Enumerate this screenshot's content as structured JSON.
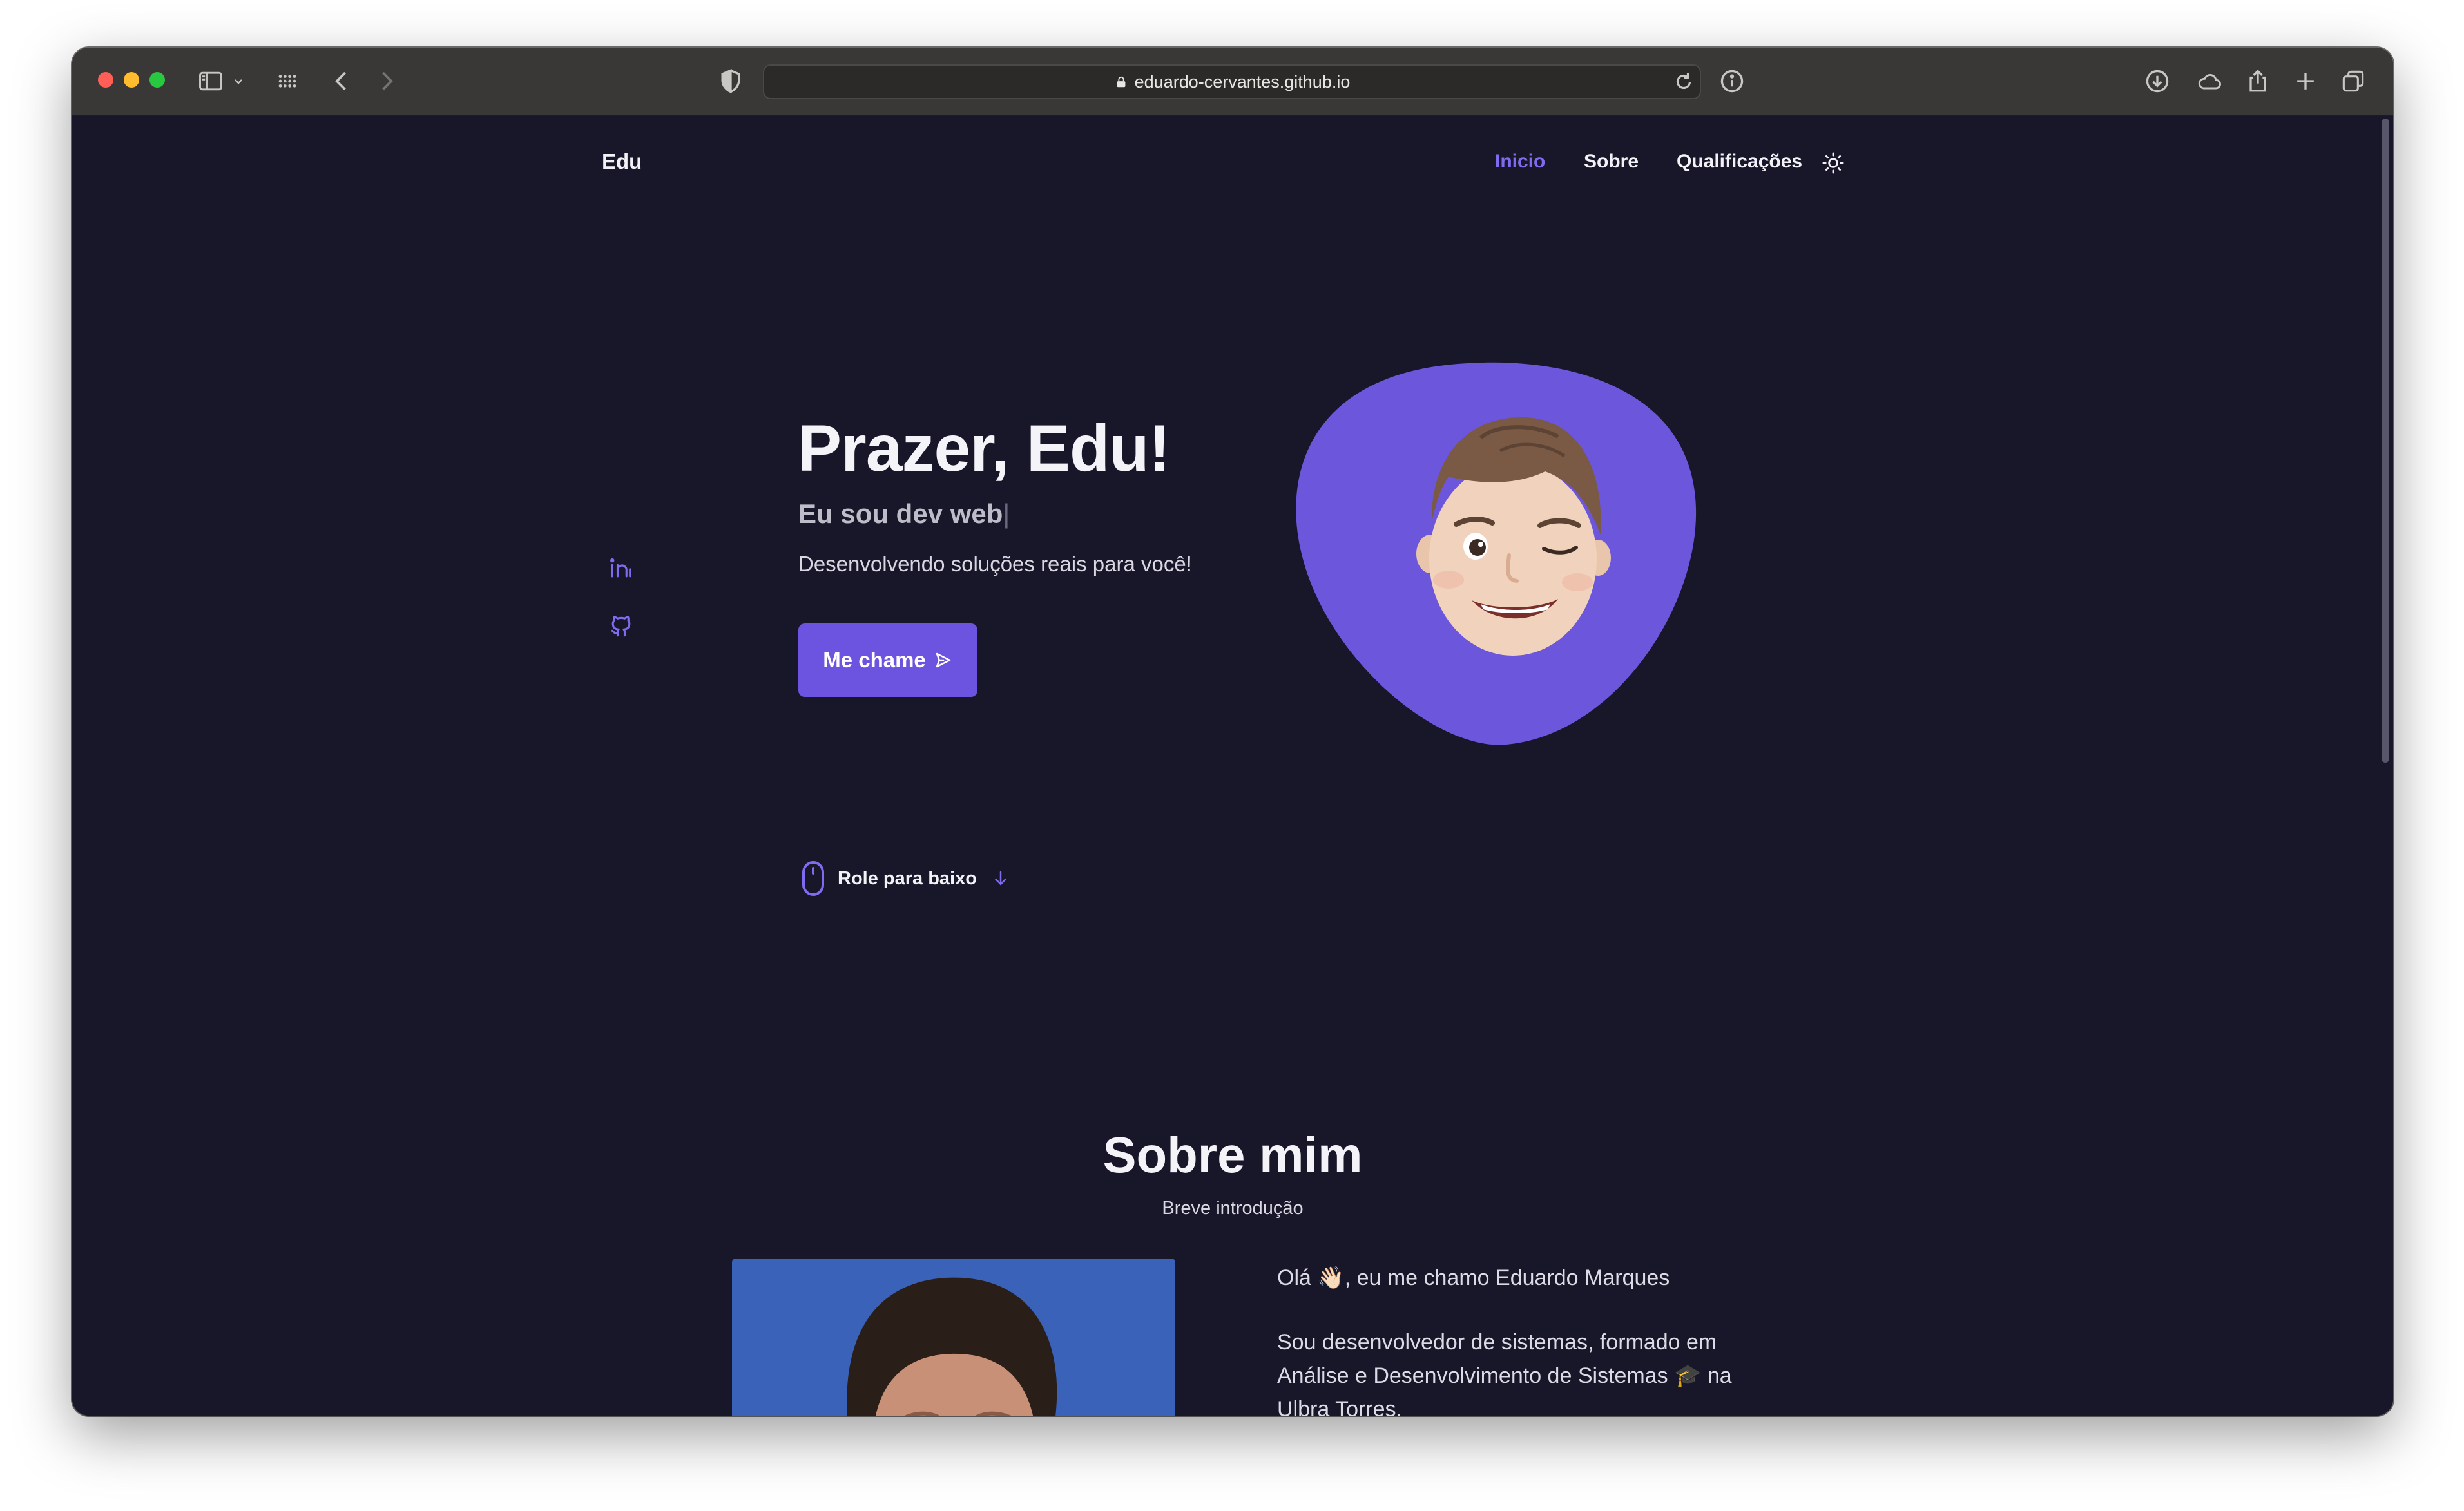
{
  "browser": {
    "url": "eduardo-cervantes.github.io"
  },
  "nav": {
    "logo": "Edu",
    "links": [
      "Inicio",
      "Sobre",
      "Qualificações"
    ],
    "active": "Inicio"
  },
  "hero": {
    "title": "Prazer, Edu!",
    "subtitle": "Eu sou dev web",
    "caret": "|",
    "description": "Desenvolvendo soluções reais para você!",
    "cta_label": "Me chame",
    "scroll_label": "Role para baixo",
    "socials": [
      "linkedin-icon",
      "github-icon"
    ]
  },
  "about": {
    "title": "Sobre mim",
    "subtitle": "Breve introdução",
    "greeting": "Olá 👋🏻, eu me chamo Eduardo Marques",
    "bio": "Sou desenvolvedor de sistemas, formado em Análise e Desenvolvimento de Sistemas 🎓 na Ulbra Torres."
  },
  "colors": {
    "background": "#181629",
    "accent": "#6d54e0",
    "accent_light": "#7e6bf0",
    "blob": "#6b56dc",
    "text": "#f2f1f6",
    "titlebar": "#3a3836"
  }
}
